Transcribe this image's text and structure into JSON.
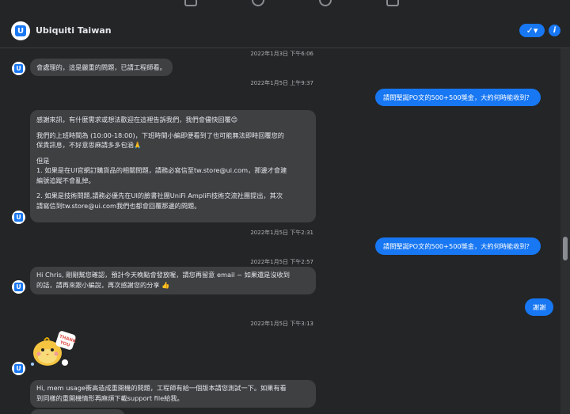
{
  "header": {
    "page_name": "Ubiquiti Taiwan",
    "check_icon": "✓▾",
    "info_icon": "i"
  },
  "messages": {
    "ts1": "2022年1月3日 下午6:06",
    "in1": "會處理的，這是嚴重的問題，已請工程師看。",
    "ts2": "2022年1月5日 上午9:37",
    "out1": "請問聖誕PO文的500+500獎金，大約何時能收到？",
    "in2": {
      "l1": "感謝來訊，有什麼需求或想法歡迎在這裡告訴我們，我們會儘快回覆😊",
      "l2": "我們的上班時間為 (10:00-18:00)，下班時間小編即便看到了也可能無法即時回覆您的",
      "l3": "保貴訊息，不好意思麻請多多包涵🙏",
      "l4": "但是",
      "l5": "1. 如果是在UI官網訂購貨品的相關問題，請務必寫信至tw.store@ui.com，那邊才會建",
      "l6": "編號追蹤不會亂掉。",
      "l7": "2. 如果是技術問題,請務必優先在UI的臉書社團UniFi AmpliFi技術交流社團提出，其次",
      "l8": "請寫信到tw.store@ui.com我們也都會回覆那邊的問題。"
    },
    "ts3": "2022年1月5日 下午2:31",
    "out2": "請問聖誕PO文的500+500獎金，大約何時能收到？",
    "ts4": "2022年1月5日 下午2:57",
    "in3": {
      "l1": "Hi Chris, 剛剛幫您確認，預計今天晚點會發放喔，請您再留意 email ~ 如果還是沒收到",
      "l2": "的話，請再來跟小編說，再次感謝您的分享 👍"
    },
    "out3": "謝謝",
    "ts5": "2022年1月5日 下午3:13",
    "sticker_text": "THANK YOU",
    "in4": {
      "l1": "Hi, mem usage衝高造成重開機的問題，工程師有給一個版本請您測試一下。如果有看",
      "l2": "到同樣的重開機情形再麻煩下載support file給我。"
    }
  },
  "colors": {
    "background": "#242526",
    "incoming_bubble": "#3e4042",
    "outgoing_bubble": "#1877f2",
    "timestamp": "#b0b3b8"
  }
}
